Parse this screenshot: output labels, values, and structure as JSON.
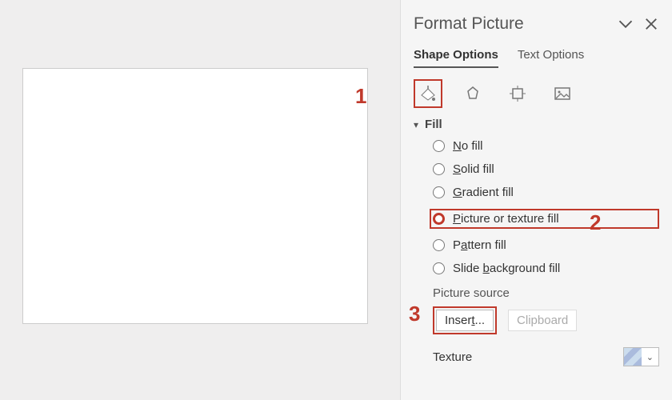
{
  "colors": {
    "accent_red": "#c0392b"
  },
  "pane": {
    "title": "Format Picture",
    "tabs": {
      "shape": "Shape Options",
      "text": "Text Options",
      "active": "shape"
    },
    "categories": [
      "fill-line-icon",
      "effects-icon",
      "size-icon",
      "picture-icon"
    ],
    "fill_section": {
      "label": "Fill",
      "options": {
        "no_fill": "No fill",
        "solid_fill": "Solid fill",
        "gradient_fill": "Gradient fill",
        "picture_texture_fill": "Picture or texture fill",
        "pattern_fill": "Pattern fill",
        "slide_background_fill": "Slide background fill"
      },
      "selected": "picture_texture_fill"
    },
    "picture_source": {
      "label": "Picture source",
      "insert_btn": "Insert...",
      "clipboard_btn": "Clipboard"
    },
    "texture": {
      "label": "Texture"
    }
  },
  "annotations": {
    "step1": "1",
    "step2": "2",
    "step3": "3"
  }
}
